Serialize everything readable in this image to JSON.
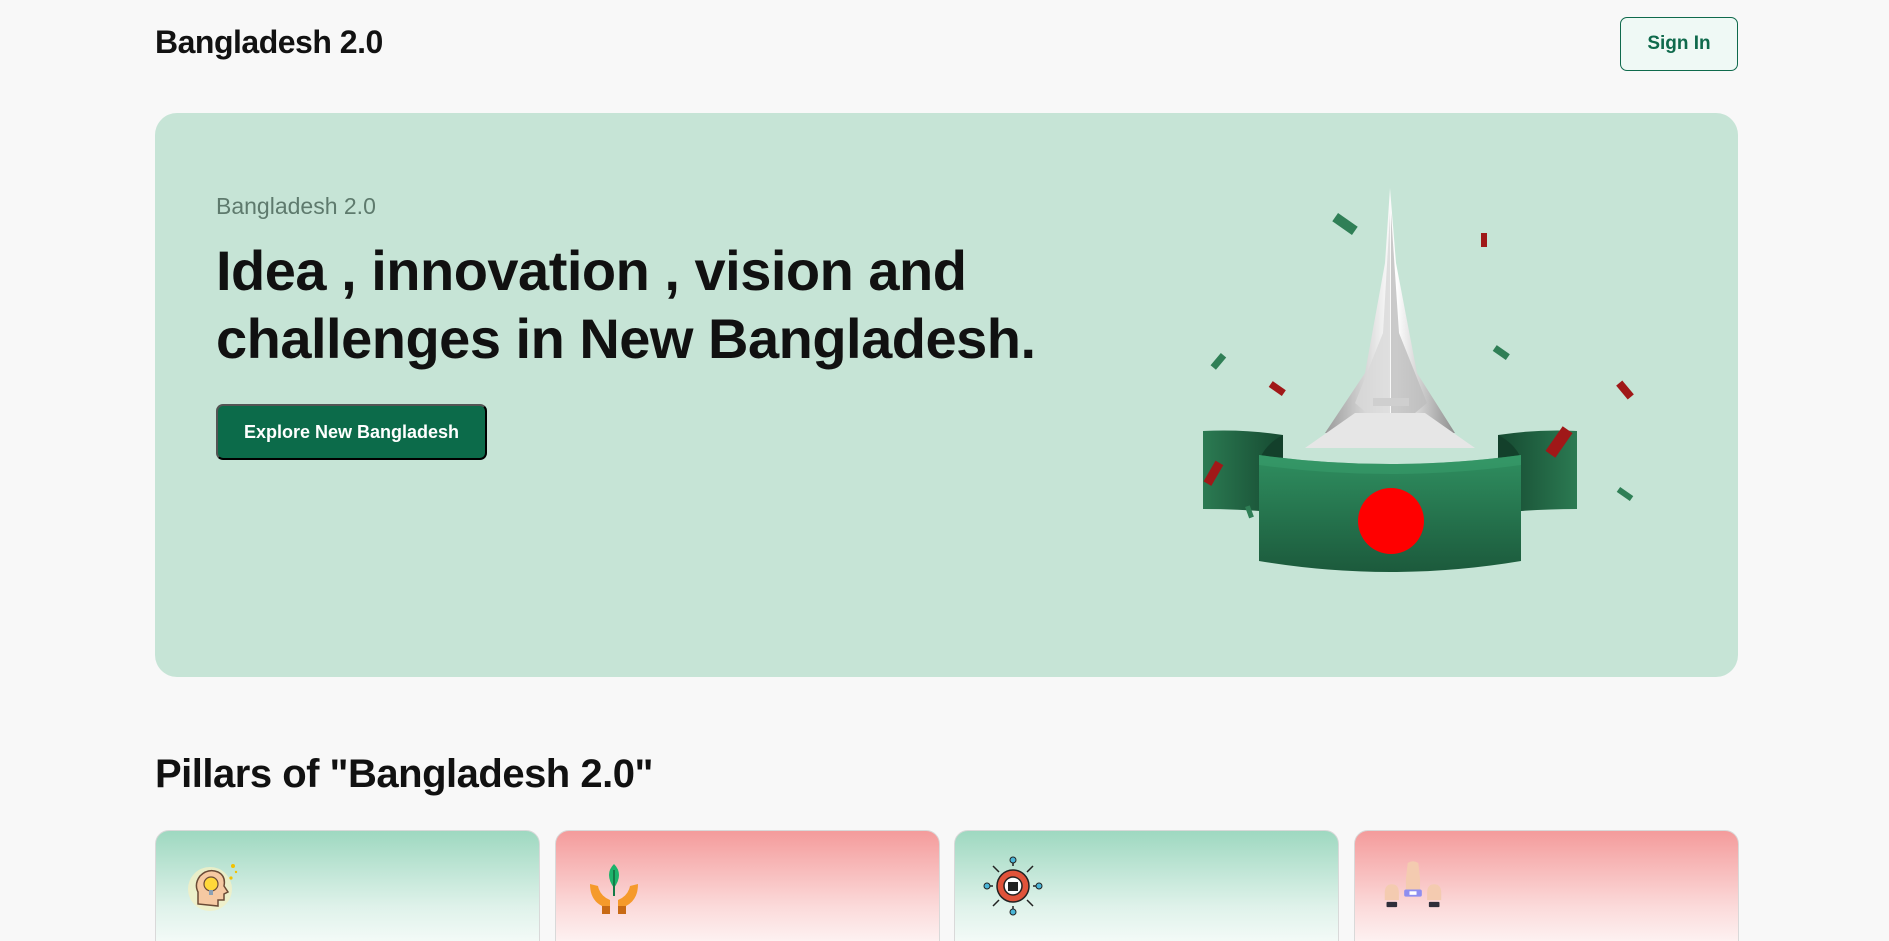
{
  "header": {
    "brand": "Bangladesh 2.0",
    "sign_in_label": "Sign In"
  },
  "hero": {
    "eyebrow": "Bangladesh 2.0",
    "title": "Idea , innovation , vision and challenges in New Bangladesh.",
    "cta_label": "Explore New Bangladesh",
    "illustration": "national-memorial-with-flag-ribbon",
    "colors": {
      "background": "#c6e4d6",
      "green": "#0c6b4a",
      "flag_red": "#ff0000"
    }
  },
  "pillars": {
    "title": "Pillars of \"Bangladesh 2.0\"",
    "cards": [
      {
        "icon": "idea-head-icon",
        "theme": "green"
      },
      {
        "icon": "sprout-in-hands-icon",
        "theme": "red"
      },
      {
        "icon": "innovation-gear-icon",
        "theme": "green"
      },
      {
        "icon": "unity-fists-icon",
        "theme": "red"
      }
    ]
  }
}
